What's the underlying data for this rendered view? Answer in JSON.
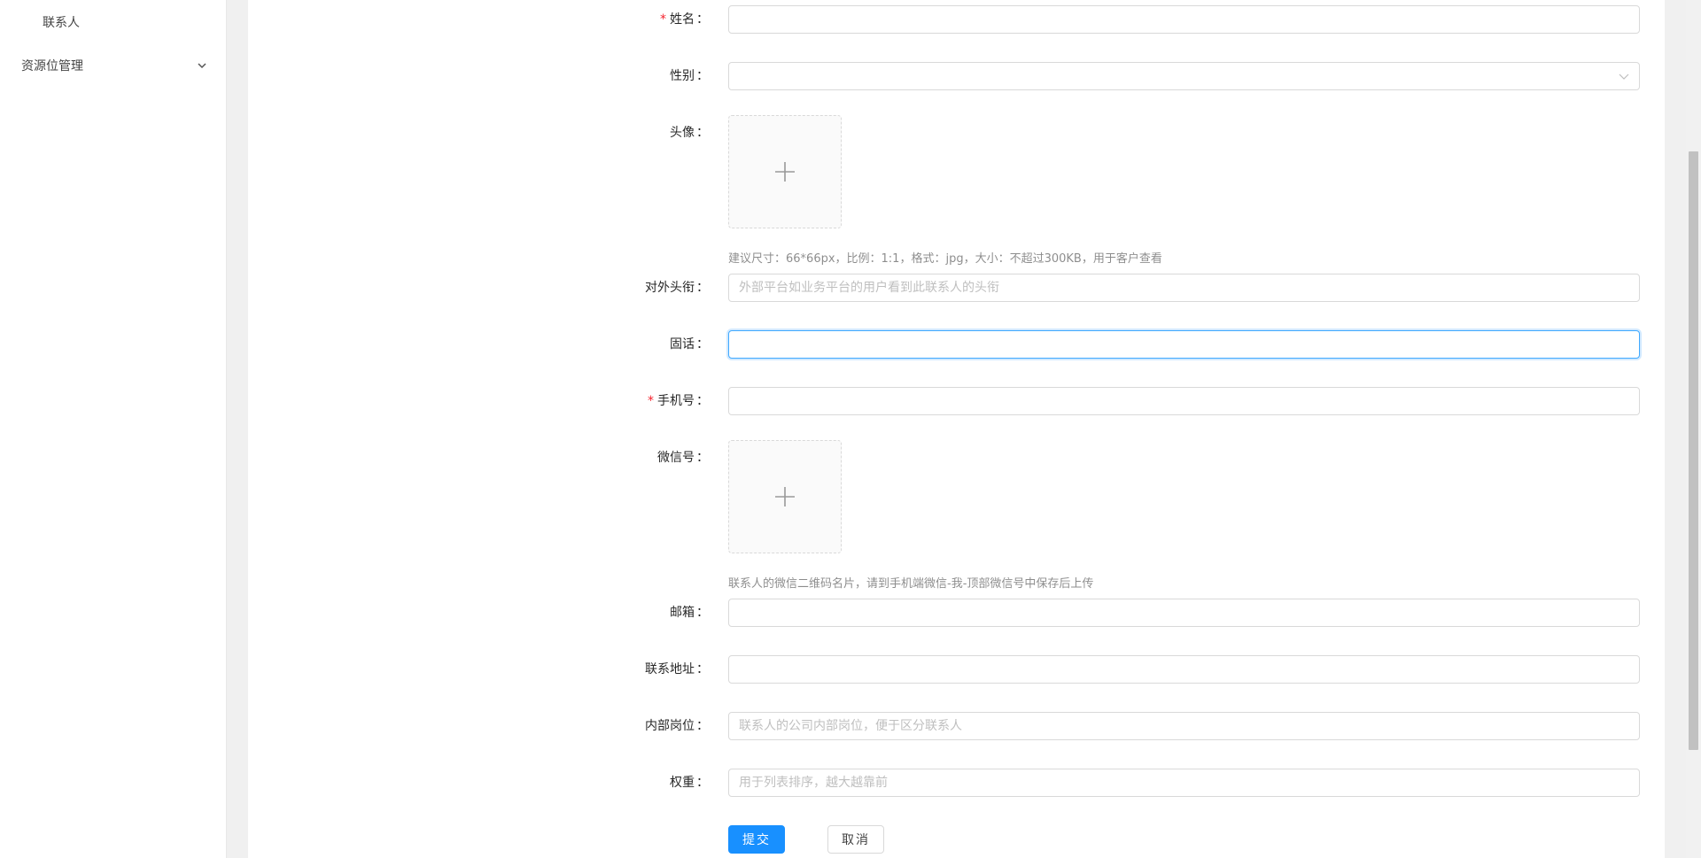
{
  "sidebar": {
    "items": [
      {
        "label": "联系人"
      },
      {
        "label": "资源位管理"
      }
    ]
  },
  "form": {
    "name": {
      "label": "姓名",
      "value": "",
      "placeholder": ""
    },
    "gender": {
      "label": "性别",
      "value": ""
    },
    "avatar": {
      "label": "头像",
      "hint": "建议尺寸：66*66px，比例：1:1，格式：jpg，大小：不超过300KB，用于客户查看"
    },
    "title": {
      "label": "对外头衔",
      "value": "",
      "placeholder": "外部平台如业务平台的用户看到此联系人的头衔"
    },
    "landline": {
      "label": "固话",
      "value": "",
      "placeholder": ""
    },
    "mobile": {
      "label": "手机号",
      "value": "",
      "placeholder": ""
    },
    "wechat": {
      "label": "微信号",
      "hint": "联系人的微信二维码名片，请到手机端微信-我-顶部微信号中保存后上传"
    },
    "email": {
      "label": "邮箱",
      "value": "",
      "placeholder": ""
    },
    "address": {
      "label": "联系地址",
      "value": "",
      "placeholder": ""
    },
    "position": {
      "label": "内部岗位",
      "value": "",
      "placeholder": "联系人的公司内部岗位，便于区分联系人"
    },
    "weight": {
      "label": "权重",
      "value": "",
      "placeholder": "用于列表排序，越大越靠前"
    },
    "required_mark": "*",
    "colon": "："
  },
  "actions": {
    "submit_label": "提交",
    "cancel_label": "取消"
  },
  "colors": {
    "primary": "#1890ff",
    "required": "#f5222d",
    "border": "#d9d9d9",
    "focus_border": "#40a9ff"
  }
}
